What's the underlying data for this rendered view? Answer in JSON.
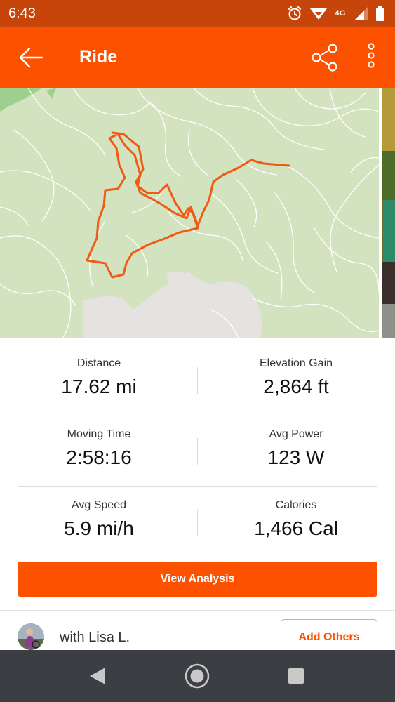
{
  "status_bar": {
    "time": "6:43",
    "network_label": "4G",
    "icons": [
      "alarm-icon",
      "data-saver-icon",
      "signal-icon",
      "battery-icon"
    ]
  },
  "app_bar": {
    "title": "Ride",
    "icons": [
      "back-arrow-icon",
      "share-icon",
      "more-vert-icon"
    ]
  },
  "colors": {
    "accent": "#fc5200",
    "status_bar": "#c7440a",
    "nav_bar": "#3b3e42",
    "map_land": "#d3e2bf",
    "route": "#f05a14"
  },
  "stats": [
    [
      {
        "label": "Distance",
        "value": "17.62 mi"
      },
      {
        "label": "Elevation Gain",
        "value": "2,864 ft"
      }
    ],
    [
      {
        "label": "Moving Time",
        "value": "2:58:16"
      },
      {
        "label": "Avg Power",
        "value": "123 W"
      }
    ],
    [
      {
        "label": "Avg Speed",
        "value": "5.9 mi/h"
      },
      {
        "label": "Calories",
        "value": "1,466 Cal"
      }
    ]
  ],
  "actions": {
    "view_analysis": "View Analysis",
    "add_others": "Add Others"
  },
  "with_athletes": {
    "text": "with Lisa L."
  },
  "nav_bar": {
    "icons": [
      "nav-back-icon",
      "nav-home-icon",
      "nav-recents-icon"
    ]
  }
}
